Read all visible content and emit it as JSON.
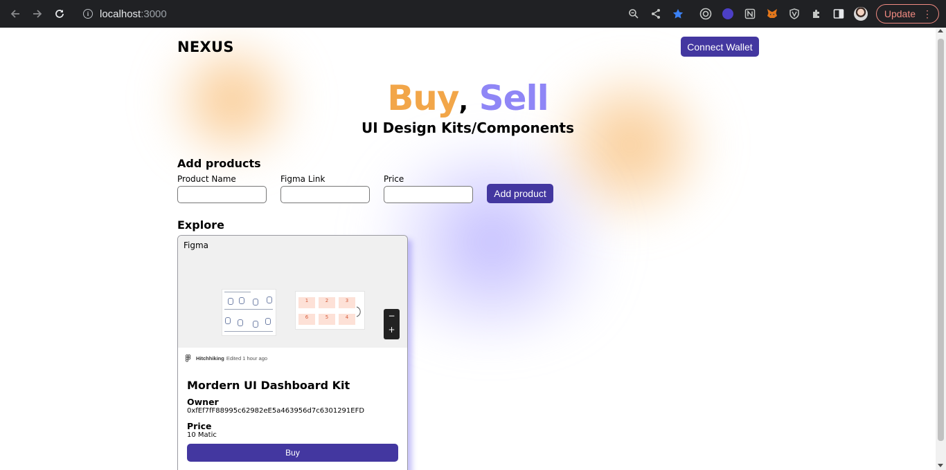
{
  "browser": {
    "url_host": "localhost",
    "url_port": ":3000",
    "update_label": "Update",
    "extensions": [
      "zoom-icon",
      "share-icon",
      "bookmark-star-icon",
      "radar-extension-icon",
      "chat-extension-icon",
      "notion-extension-icon",
      "metamask-extension-icon",
      "shield-extension-icon",
      "puzzle-extensions-icon",
      "sidepanel-icon",
      "profile-avatar"
    ]
  },
  "header": {
    "logo": "NEXUS",
    "connect_label": "Connect Wallet"
  },
  "hero": {
    "buy": "Buy",
    "comma": ",",
    "sell": "Sell",
    "subtitle": "UI Design Kits/Components"
  },
  "add_products": {
    "title": "Add products",
    "fields": [
      {
        "label": "Product Name",
        "value": "",
        "placeholder": ""
      },
      {
        "label": "Figma Link",
        "value": "",
        "placeholder": ""
      },
      {
        "label": "Price",
        "value": "",
        "placeholder": ""
      }
    ],
    "submit_label": "Add product"
  },
  "explore": {
    "title": "Explore",
    "products": [
      {
        "embed_brand": "Figma",
        "file_name": "Hitchhiking",
        "edited": "Edited 1 hour ago",
        "zoom_out": "−",
        "zoom_in": "+",
        "steps": [
          "1",
          "2",
          "3",
          "6",
          "5",
          "4"
        ],
        "title": "Mordern UI Dashboard Kit",
        "owner_label": "Owner",
        "owner": "0xfEf7fF88995c62982eE5a463956d7c6301291EFD",
        "price_label": "Price",
        "price": "10 Matic",
        "buy_label": "Buy"
      }
    ]
  },
  "colors": {
    "accent": "#4337a0",
    "buy_orange": "#f2a649",
    "sell_purple": "#8f86f6",
    "chrome_bg": "#202124",
    "update_red": "#f28b82"
  }
}
